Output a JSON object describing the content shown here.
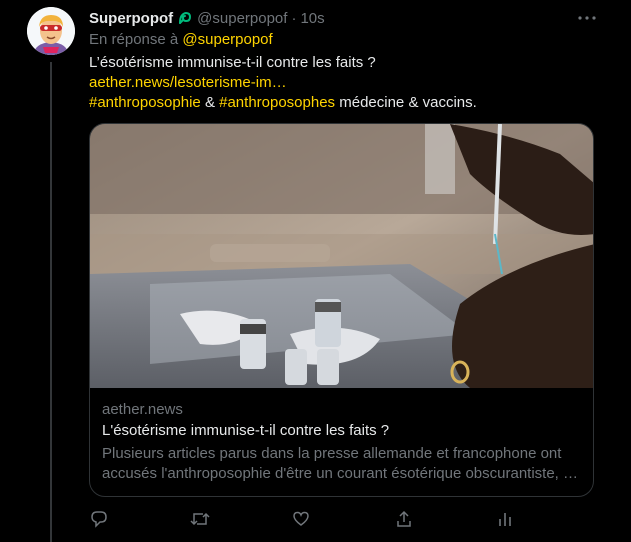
{
  "tweet": {
    "display_name": "Superpopof",
    "handle": "@superpopof",
    "separator": "·",
    "time": "10s",
    "reply_prefix": "En réponse à",
    "reply_to": "@superpopof",
    "text_line1": "L’ésotérisme immunise-t-il contre les faits ?",
    "link": "aether.news/lesoterisme-im…",
    "hashtag1": "#anthroposophie",
    "amp": "&",
    "hashtag2": "#anthroposophes",
    "text_tail": "médecine & vaccins."
  },
  "card": {
    "domain": "aether.news",
    "title": "L'ésotérisme immunise-t-il contre les faits ?",
    "desc_line1": "Plusieurs articles parus dans la presse allemande et francophone ont",
    "desc_line2": "accusés l'anthroposophie d'être un courant ésotérique obscurantiste, …"
  },
  "colors": {
    "background": "#000000",
    "text": "#e7e9ea",
    "muted": "#71767b",
    "accent": "#ffd400",
    "border": "#2f3336",
    "verified_badge": "#00ba7c"
  },
  "icons": {
    "avatar": "memoji-avatar",
    "badge": "leaf-badge-icon",
    "more": "more-dots-icon",
    "reply": "reply-icon",
    "retweet": "retweet-icon",
    "like": "heart-icon",
    "share": "share-icon",
    "analytics": "analytics-icon"
  }
}
